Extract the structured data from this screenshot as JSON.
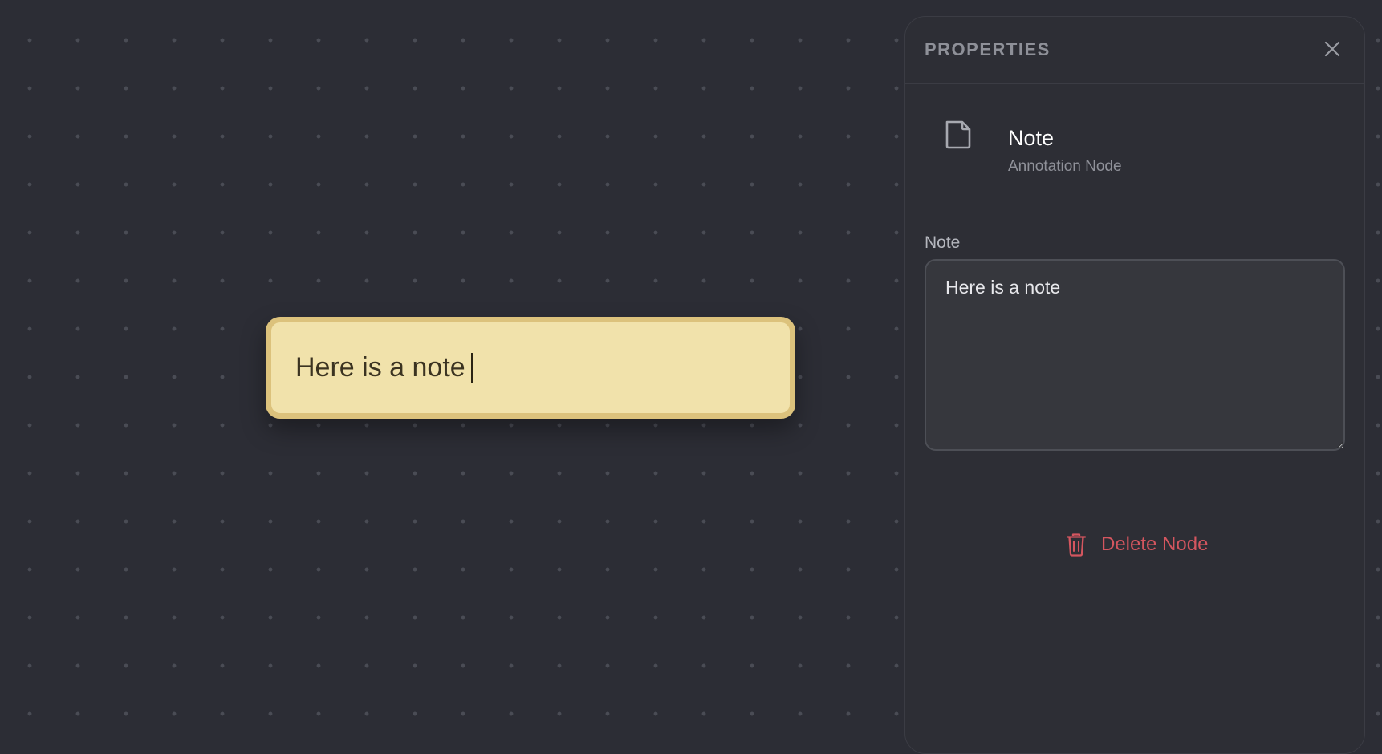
{
  "canvas": {
    "note_node": {
      "text": "Here is a note"
    }
  },
  "panel": {
    "title": "PROPERTIES",
    "node": {
      "name": "Note",
      "type": "Annotation Node",
      "icon": "note-icon"
    },
    "note_field": {
      "label": "Note",
      "value": "Here is a note"
    },
    "delete_label": "Delete Node"
  },
  "colors": {
    "canvas_bg": "#2c2d35",
    "note_fill": "#f1e2ab",
    "note_border": "#dcc27c",
    "panel_bg": "#2d2e35",
    "danger": "#d4565f"
  }
}
